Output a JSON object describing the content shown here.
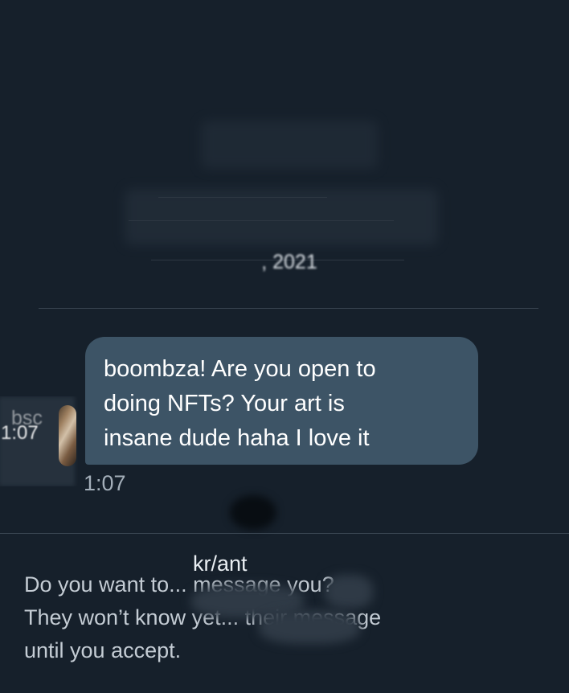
{
  "conversation": {
    "date_fragment": ", 2021",
    "sender_name_fragment": "bsc",
    "sender_time_fragment": "1:07",
    "message": {
      "text": "boombza! Are you open to\ndoing NFTs? Your art is\ninsane dude haha I love it",
      "timestamp": "1:07"
    },
    "request": {
      "label_fragment": "kr/ant",
      "prompt": "Do you want to... message you?\nThey won’t know yet... their message\nuntil you accept."
    }
  },
  "colors": {
    "background": "#16202b",
    "bubble": "#3d5466",
    "secondary_text": "#a4afba"
  }
}
